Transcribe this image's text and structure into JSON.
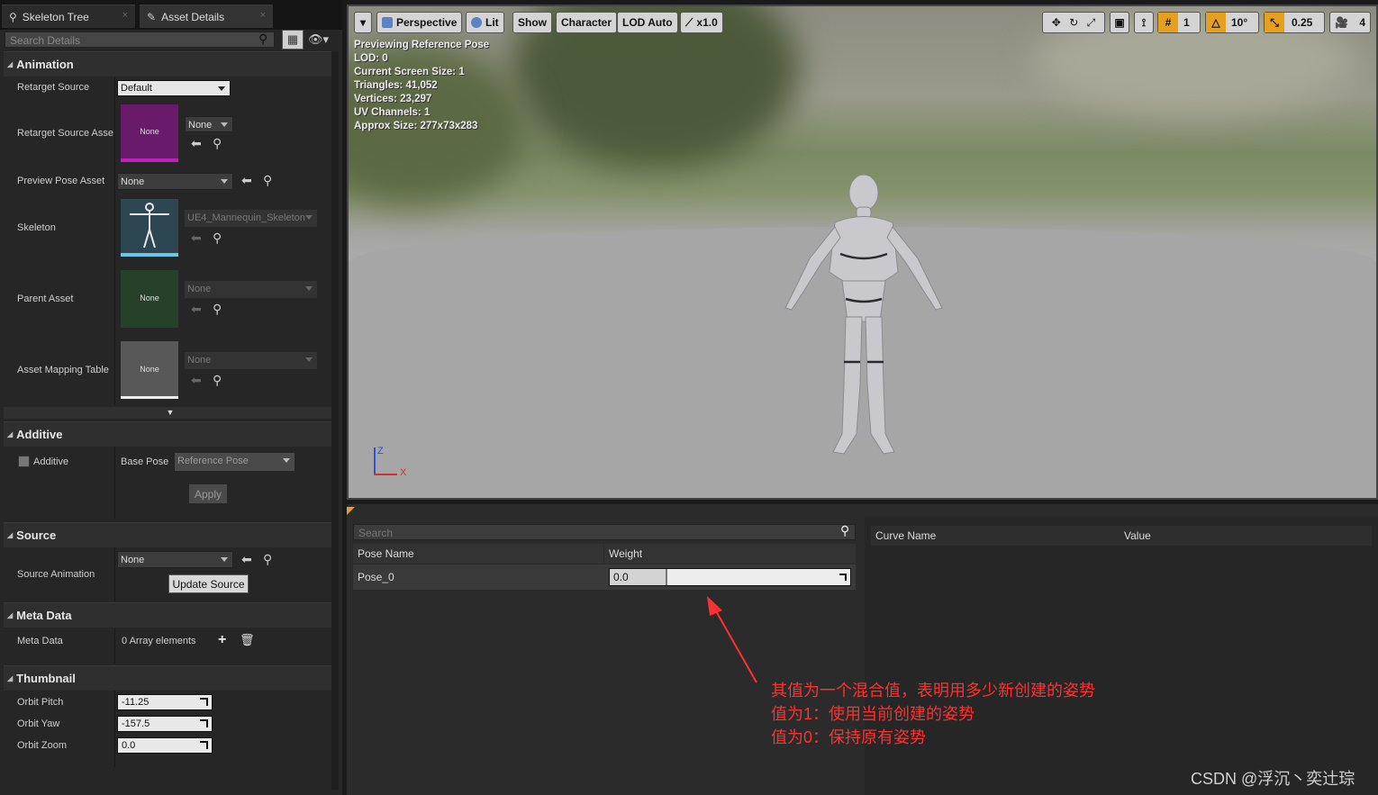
{
  "tabs": [
    {
      "label": "Skeleton Tree",
      "close": "×"
    },
    {
      "label": "Asset Details",
      "close": "×"
    }
  ],
  "details": {
    "search_placeholder": "Search Details",
    "animation": {
      "header": "Animation",
      "retarget_source": {
        "label": "Retarget Source",
        "value": "Default"
      },
      "retarget_source_asset": {
        "label": "Retarget Source Asse",
        "thumb": "None",
        "value": "None"
      },
      "preview_pose_asset": {
        "label": "Preview Pose Asset",
        "value": "None"
      },
      "skeleton": {
        "label": "Skeleton",
        "value": "UE4_Mannequin_Skeleton"
      },
      "parent_asset": {
        "label": "Parent Asset",
        "thumb": "None",
        "value": "None"
      },
      "asset_mapping_table": {
        "label": "Asset Mapping Table",
        "thumb": "None",
        "value": "None"
      }
    },
    "additive": {
      "header": "Additive",
      "checkbox_label": "Additive",
      "base_pose_label": "Base Pose",
      "base_pose_value": "Reference Pose",
      "apply": "Apply"
    },
    "source": {
      "header": "Source",
      "label": "Source Animation",
      "value": "None",
      "update": "Update Source"
    },
    "meta": {
      "header": "Meta Data",
      "label": "Meta Data",
      "value": "0 Array elements"
    },
    "thumbnail": {
      "header": "Thumbnail",
      "orbit_pitch": {
        "label": "Orbit Pitch",
        "value": "-11.25"
      },
      "orbit_yaw": {
        "label": "Orbit Yaw",
        "value": "-157.5"
      },
      "orbit_zoom": {
        "label": "Orbit Zoom",
        "value": "0.0"
      }
    }
  },
  "viewport": {
    "toolbar": {
      "perspective": "Perspective",
      "lit": "Lit",
      "show": "Show",
      "character": "Character",
      "lod": "LOD Auto",
      "speed": "x1.0",
      "grid": "1",
      "angle": "10°",
      "scale": "0.25",
      "camera_speed": "4"
    },
    "stats": [
      "Previewing Reference Pose",
      "LOD: 0",
      "Current Screen Size: 1",
      "Triangles: 41,052",
      "Vertices: 23,297",
      "UV Channels: 1",
      "Approx Size: 277x73x283"
    ],
    "axis_z": "Z",
    "axis_x": "X"
  },
  "pose_panel": {
    "search_placeholder": "Search",
    "col_pose_name": "Pose Name",
    "col_weight": "Weight",
    "rows": [
      {
        "name": "Pose_0",
        "weight": "0.0",
        "weight_fraction": 0.24
      }
    ],
    "col_curve_name": "Curve Name",
    "col_value": "Value"
  },
  "annotation": {
    "lines": [
      "其值为一个混合值，表明用多少新创建的姿势",
      "值为1：使用当前创建的姿势",
      "值为0：保持原有姿势"
    ],
    "color": "#ff3030"
  },
  "watermark": "CSDN @浮沉丶奕辻琮"
}
